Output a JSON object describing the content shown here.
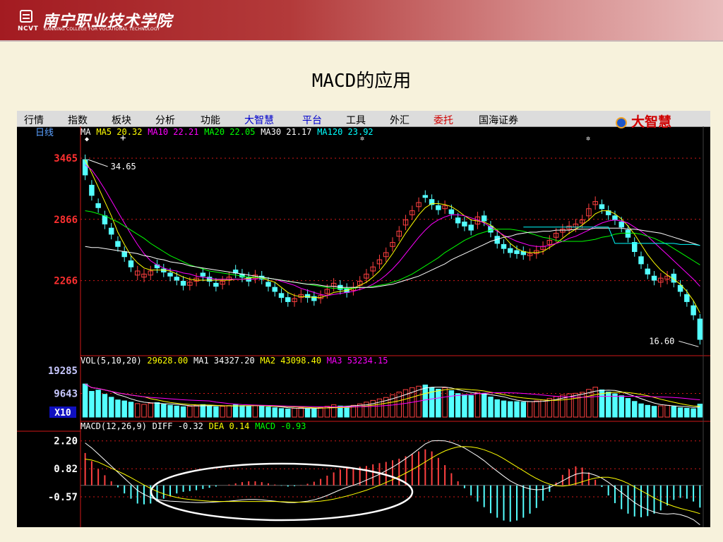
{
  "header": {
    "logo_name": "南宁职业技术学院",
    "logo_abbr": "NCVT",
    "logo_en": "NANNING COLLEGE FOR VOCATIONAL TECHNOLOGY"
  },
  "slide": {
    "title": "MACD的应用"
  },
  "menu": {
    "items": [
      {
        "label": "行情",
        "color": "#000000"
      },
      {
        "label": "指数",
        "color": "#000000"
      },
      {
        "label": "板块",
        "color": "#000000"
      },
      {
        "label": "分析",
        "color": "#000000"
      },
      {
        "label": "功能",
        "color": "#000000"
      },
      {
        "label": "大智慧",
        "color": "#0000cc"
      },
      {
        "label": "平台",
        "color": "#0000cc"
      },
      {
        "label": "工具",
        "color": "#000000"
      },
      {
        "label": "外汇",
        "color": "#000000"
      },
      {
        "label": "委托",
        "color": "#d00000"
      },
      {
        "label": "国海证券",
        "color": "#000000"
      }
    ],
    "brand": "大智慧"
  },
  "panels": {
    "price": {
      "period_label": "日线",
      "legend": [
        {
          "text": "MA",
          "color": "#ffffff"
        },
        {
          "text": "MA5 20.32",
          "color": "#ffff00"
        },
        {
          "text": "MA10 22.21",
          "color": "#ff00ff"
        },
        {
          "text": "MA20 22.05",
          "color": "#00ff00"
        },
        {
          "text": "MA30 21.17",
          "color": "#ffffff"
        },
        {
          "text": "MA120 23.92",
          "color": "#00ffff"
        }
      ],
      "ticks": [
        "3465",
        "2866",
        "2266"
      ],
      "high_label": "34.65",
      "low_label": "16.60"
    },
    "volume": {
      "legend": [
        {
          "text": "VOL(5,10,20)",
          "color": "#ffffff"
        },
        {
          "text": "29628.00",
          "color": "#ffff00"
        },
        {
          "text": "MA1 34327.20",
          "color": "#ffffff"
        },
        {
          "text": "MA2 43098.40",
          "color": "#ffff00"
        },
        {
          "text": "MA3 53234.15",
          "color": "#ff00ff"
        }
      ],
      "ticks": [
        "19285",
        "9643"
      ],
      "unit_label": "X10"
    },
    "macd": {
      "legend": [
        {
          "text": "MACD(12,26,9)",
          "color": "#ffffff"
        },
        {
          "text": "DIFF -0.32",
          "color": "#ffffff"
        },
        {
          "text": "DEA 0.14",
          "color": "#ffff00"
        },
        {
          "text": "MACD -0.93",
          "color": "#00ff00"
        }
      ],
      "ticks": [
        "2.20",
        "0.82",
        "-0.57"
      ]
    }
  },
  "colors": {
    "up": "#ff4040",
    "down": "#54ffff",
    "axis_red": "#d01818",
    "price_tick": "#ff3030",
    "vol_tick": "#c8c8ff"
  },
  "chart_data": {
    "type": "candlestick",
    "price_axis": [
      1300,
      3600
    ],
    "price_ticks": [
      34.65,
      28.66,
      22.66
    ],
    "annotations": {
      "high": 34.65,
      "low": 16.6
    },
    "close": [
      33.0,
      31.0,
      29.8,
      28.2,
      27.2,
      26.0,
      25.0,
      24.0,
      23.6,
      23.3,
      23.6,
      23.9,
      23.5,
      23.1,
      22.7,
      22.2,
      22.5,
      22.9,
      23.1,
      22.6,
      22.1,
      22.6,
      23.0,
      23.4,
      23.0,
      22.6,
      23.2,
      22.8,
      22.1,
      21.6,
      21.0,
      20.6,
      20.9,
      21.3,
      21.0,
      20.7,
      21.2,
      21.8,
      22.4,
      21.8,
      21.5,
      22.0,
      22.6,
      23.3,
      24.0,
      24.7,
      25.4,
      26.4,
      27.5,
      28.6,
      29.5,
      30.3,
      30.8,
      30.1,
      29.6,
      30.0,
      29.2,
      28.3,
      28.0,
      27.6,
      28.9,
      28.5,
      27.4,
      26.3,
      25.8,
      25.4,
      25.3,
      25.2,
      25.3,
      25.6,
      26.0,
      26.6,
      27.3,
      27.7,
      28.0,
      28.2,
      28.6,
      29.7,
      30.4,
      29.7,
      29.1,
      28.6,
      27.9,
      26.9,
      25.5,
      24.3,
      23.3,
      22.7,
      22.9,
      23.1,
      22.5,
      21.6,
      20.6,
      19.3,
      16.9
    ],
    "open": [
      34.5,
      32.0,
      30.2,
      29.0,
      27.8,
      26.5,
      25.5,
      24.6,
      23.2,
      23.0,
      23.2,
      24.2,
      23.8,
      23.4,
      23.0,
      22.6,
      22.2,
      22.6,
      23.4,
      23.0,
      22.4,
      22.3,
      22.7,
      23.7,
      23.3,
      23.0,
      22.9,
      23.1,
      22.5,
      22.0,
      21.4,
      21.0,
      20.6,
      21.0,
      21.3,
      21.1,
      20.9,
      21.4,
      22.1,
      22.2,
      21.9,
      21.7,
      22.2,
      22.9,
      23.6,
      24.3,
      25.0,
      26.0,
      27.0,
      28.1,
      29.1,
      29.9,
      31.0,
      30.6,
      30.0,
      29.7,
      29.6,
      28.8,
      28.4,
      28.1,
      28.2,
      29.0,
      28.0,
      27.0,
      26.2,
      25.8,
      25.6,
      25.5,
      25.1,
      25.3,
      25.7,
      26.2,
      26.9,
      27.4,
      27.7,
      27.9,
      28.3,
      29.0,
      30.1,
      30.1,
      29.5,
      29.0,
      28.4,
      27.6,
      26.4,
      25.0,
      23.8,
      23.1,
      22.5,
      22.8,
      23.3,
      22.2,
      21.3,
      20.2,
      18.9
    ],
    "volume": [
      13500,
      10500,
      11000,
      9300,
      8100,
      7000,
      6600,
      6100,
      5500,
      5200,
      5600,
      5900,
      5200,
      4800,
      4500,
      4200,
      4400,
      4800,
      5100,
      4600,
      4200,
      4400,
      4700,
      5000,
      4700,
      4400,
      4800,
      4600,
      4100,
      3800,
      3500,
      3300,
      3600,
      3800,
      3500,
      3400,
      3900,
      4400,
      5000,
      4500,
      4300,
      4800,
      5400,
      6100,
      6800,
      7400,
      8000,
      9100,
      10200,
      11200,
      12000,
      12600,
      13100,
      12100,
      11400,
      12000,
      10800,
      9600,
      9100,
      8800,
      10100,
      9500,
      8200,
      7100,
      6600,
      6300,
      6300,
      6100,
      6300,
      6600,
      7000,
      7600,
      8400,
      9000,
      9500,
      9700,
      10100,
      11300,
      12200,
      11100,
      10200,
      9500,
      8700,
      7600,
      6400,
      5400,
      4800,
      4400,
      4600,
      4800,
      4300,
      3800,
      3600,
      3400,
      5300
    ],
    "series": [
      {
        "name": "MA5",
        "values": [
          34.5,
          33.2,
          31.8,
          30.4,
          29.0,
          27.4,
          26.2,
          25.1,
          24.4,
          23.9,
          23.7,
          23.7,
          23.7,
          23.6,
          23.3,
          23.0,
          22.8,
          22.7,
          22.7,
          22.7,
          22.7,
          22.7,
          22.7,
          22.8,
          22.8,
          22.9,
          23.0,
          22.9,
          22.7,
          22.5,
          22.0,
          21.5,
          21.2,
          21.1,
          21.1,
          21.0,
          21.0,
          21.2,
          21.5,
          21.6,
          21.7,
          21.9,
          22.2,
          22.5,
          23.0,
          23.6,
          24.4,
          25.3,
          26.3,
          27.3,
          28.2,
          29.1,
          29.8,
          30.2,
          30.2,
          30.1,
          29.9,
          29.5,
          29.0,
          28.6,
          28.5,
          28.4,
          28.1,
          27.6,
          27.0,
          26.3,
          25.8,
          25.5,
          25.4,
          25.4,
          25.5,
          25.9,
          26.3,
          26.8,
          27.3,
          27.7,
          28.1,
          28.6,
          29.2,
          29.5,
          29.5,
          29.2,
          28.7,
          28.0,
          27.2,
          26.2,
          25.2,
          24.4,
          23.7,
          23.2,
          22.8,
          22.3,
          21.6,
          20.7,
          19.5
        ]
      },
      {
        "name": "MA10",
        "values": [
          34.0,
          33.5,
          32.6,
          31.6,
          30.5,
          29.4,
          28.3,
          27.2,
          26.2,
          25.3,
          24.6,
          24.2,
          23.9,
          23.7,
          23.6,
          23.4,
          23.3,
          23.1,
          23.0,
          22.9,
          22.8,
          22.8,
          22.8,
          22.8,
          22.8,
          22.8,
          22.8,
          22.9,
          22.9,
          22.8,
          22.6,
          22.4,
          22.2,
          21.9,
          21.7,
          21.5,
          21.3,
          21.2,
          21.3,
          21.4,
          21.5,
          21.6,
          21.8,
          22.0,
          22.3,
          22.7,
          23.2,
          23.8,
          24.5,
          25.3,
          26.1,
          26.9,
          27.6,
          28.2,
          28.6,
          28.9,
          29.1,
          29.1,
          29.0,
          28.8,
          28.6,
          28.3,
          27.9,
          27.5,
          27.1,
          26.8,
          26.5,
          26.3,
          26.1,
          26.0,
          26.0,
          26.1,
          26.3,
          26.5,
          26.8,
          27.0,
          27.3,
          27.6,
          28.0,
          28.3,
          28.5,
          28.6,
          28.5,
          28.3,
          27.9,
          27.5,
          27.0,
          26.4,
          25.8,
          25.2,
          24.6,
          24.0,
          23.4,
          22.8,
          22.1
        ]
      },
      {
        "name": "MA20",
        "values": [
          29.5,
          29.4,
          29.2,
          29.0,
          28.7,
          28.4,
          28.0,
          27.6,
          27.2,
          26.8,
          26.3,
          25.9,
          25.5,
          25.1,
          24.8,
          24.5,
          24.2,
          24.0,
          23.8,
          23.6,
          23.5,
          23.4,
          23.3,
          23.2,
          23.1,
          23.0,
          23.0,
          22.9,
          22.9,
          22.8,
          22.7,
          22.6,
          22.5,
          22.4,
          22.3,
          22.2,
          22.1,
          22.0,
          21.9,
          21.9,
          21.9,
          21.9,
          22.0,
          22.0,
          22.1,
          22.2,
          22.3,
          22.5,
          22.7,
          23.0,
          23.3,
          23.7,
          24.1,
          24.5,
          24.9,
          25.4,
          25.8,
          26.2,
          26.6,
          26.9,
          27.2,
          27.4,
          27.6,
          27.7,
          27.7,
          27.7,
          27.6,
          27.5,
          27.3,
          27.1,
          26.9,
          26.8,
          26.6,
          26.5,
          26.5,
          26.5,
          26.5,
          26.6,
          26.7,
          26.9,
          27.0,
          27.2,
          27.3,
          27.3,
          27.3,
          27.2,
          27.0,
          26.8,
          26.5,
          26.2,
          25.8,
          25.4,
          25.0,
          24.6,
          24.2
        ]
      },
      {
        "name": "MA30",
        "values": [
          26.0,
          25.9,
          25.9,
          25.8,
          25.7,
          25.6,
          25.5,
          25.4,
          25.3,
          25.1,
          25.0,
          24.8,
          24.7,
          24.5,
          24.4,
          24.3,
          24.1,
          24.0,
          23.9,
          23.8,
          23.7,
          23.6,
          23.5,
          23.4,
          23.3,
          23.2,
          23.1,
          23.0,
          22.9,
          22.8,
          22.7,
          22.6,
          22.5,
          22.4,
          22.3,
          22.3,
          22.2,
          22.1,
          22.1,
          22.0,
          22.0,
          22.0,
          22.0,
          22.0,
          22.0,
          22.1,
          22.2,
          22.3,
          22.5,
          22.7,
          22.9,
          23.1,
          23.4,
          23.7,
          24.0,
          24.3,
          24.7,
          25.0,
          25.3,
          25.6,
          25.9,
          26.2,
          26.5,
          26.7,
          26.9,
          27.0,
          27.2,
          27.3,
          27.4,
          27.4,
          27.5,
          27.5,
          27.6,
          27.6,
          27.6,
          27.7,
          27.7,
          27.7,
          27.8,
          27.8,
          27.8,
          27.8,
          27.8,
          27.7,
          27.7,
          27.6,
          27.5,
          27.4,
          27.3,
          27.1,
          26.9,
          26.7,
          26.5,
          26.3,
          26.1
        ]
      },
      {
        "name": "MA120",
        "values": [
          null,
          null,
          null,
          null,
          null,
          null,
          null,
          null,
          null,
          null,
          null,
          null,
          null,
          null,
          null,
          null,
          null,
          null,
          null,
          null,
          null,
          null,
          null,
          null,
          null,
          null,
          null,
          null,
          null,
          null,
          null,
          null,
          null,
          null,
          null,
          null,
          null,
          null,
          null,
          null,
          null,
          null,
          null,
          null,
          null,
          null,
          null,
          null,
          null,
          null,
          null,
          null,
          null,
          null,
          null,
          null,
          null,
          null,
          null,
          null,
          null,
          null,
          null,
          null,
          null,
          null,
          null,
          27.9,
          27.9,
          27.9,
          27.9,
          27.9,
          27.9,
          27.9,
          27.9,
          27.9,
          27.9,
          27.9,
          27.9,
          27.9,
          27.9,
          26.3,
          26.3,
          26.3,
          26.3,
          26.3,
          26.3,
          26.3,
          26.3,
          26.3,
          26.3,
          26.2,
          26.2,
          26.2,
          26.1
        ]
      },
      {
        "name": "DIFF",
        "values": [
          2.1,
          1.85,
          1.55,
          1.25,
          0.95,
          0.65,
          0.35,
          0.05,
          -0.25,
          -0.45,
          -0.6,
          -0.7,
          -0.75,
          -0.78,
          -0.8,
          -0.82,
          -0.84,
          -0.85,
          -0.85,
          -0.84,
          -0.82,
          -0.8,
          -0.78,
          -0.75,
          -0.72,
          -0.7,
          -0.7,
          -0.72,
          -0.75,
          -0.78,
          -0.82,
          -0.85,
          -0.85,
          -0.82,
          -0.78,
          -0.72,
          -0.62,
          -0.5,
          -0.36,
          -0.22,
          -0.1,
          0.0,
          0.12,
          0.26,
          0.4,
          0.55,
          0.72,
          0.9,
          1.1,
          1.32,
          1.55,
          1.8,
          2.05,
          2.2,
          2.22,
          2.2,
          2.12,
          2.0,
          1.85,
          1.65,
          1.45,
          1.22,
          0.95,
          0.7,
          0.45,
          0.22,
          0.05,
          -0.08,
          -0.18,
          -0.22,
          -0.2,
          -0.1,
          0.05,
          0.22,
          0.4,
          0.55,
          0.62,
          0.6,
          0.5,
          0.36,
          0.15,
          -0.1,
          -0.35,
          -0.6,
          -0.85,
          -1.05,
          -1.2,
          -1.32,
          -1.4,
          -1.42,
          -1.4,
          -1.45,
          -1.55,
          -1.7,
          -1.95
        ]
      },
      {
        "name": "DEA",
        "values": [
          1.3,
          1.25,
          1.15,
          1.0,
          0.85,
          0.7,
          0.55,
          0.38,
          0.2,
          0.02,
          -0.15,
          -0.3,
          -0.42,
          -0.52,
          -0.6,
          -0.66,
          -0.7,
          -0.73,
          -0.76,
          -0.78,
          -0.79,
          -0.8,
          -0.8,
          -0.8,
          -0.8,
          -0.8,
          -0.8,
          -0.8,
          -0.8,
          -0.8,
          -0.81,
          -0.82,
          -0.83,
          -0.83,
          -0.82,
          -0.81,
          -0.78,
          -0.74,
          -0.68,
          -0.61,
          -0.53,
          -0.44,
          -0.34,
          -0.24,
          -0.12,
          0.0,
          0.14,
          0.28,
          0.44,
          0.6,
          0.78,
          0.96,
          1.16,
          1.36,
          1.54,
          1.7,
          1.82,
          1.9,
          1.92,
          1.9,
          1.85,
          1.76,
          1.64,
          1.5,
          1.32,
          1.12,
          0.92,
          0.72,
          0.52,
          0.34,
          0.18,
          0.06,
          -0.02,
          -0.04,
          0.0,
          0.08,
          0.18,
          0.28,
          0.36,
          0.4,
          0.4,
          0.34,
          0.24,
          0.1,
          -0.08,
          -0.26,
          -0.44,
          -0.62,
          -0.78,
          -0.92,
          -1.04,
          -1.14,
          -1.22,
          -1.3,
          -1.4
        ]
      },
      {
        "name": "MACD",
        "values": [
          1.6,
          1.2,
          0.8,
          0.5,
          0.2,
          -0.1,
          -0.4,
          -0.66,
          -0.9,
          -0.94,
          -0.9,
          -0.8,
          -0.66,
          -0.52,
          -0.4,
          -0.32,
          -0.28,
          -0.24,
          -0.18,
          -0.12,
          -0.06,
          0.0,
          0.04,
          0.1,
          0.16,
          0.2,
          0.2,
          0.16,
          0.1,
          0.04,
          -0.02,
          -0.06,
          -0.04,
          0.02,
          0.08,
          0.18,
          0.32,
          0.48,
          0.64,
          0.78,
          0.86,
          0.88,
          0.92,
          0.96,
          1.04,
          1.1,
          1.16,
          1.24,
          1.32,
          1.44,
          1.54,
          1.68,
          1.78,
          1.68,
          1.36,
          1.0,
          0.6,
          0.2,
          -0.14,
          -0.5,
          -0.8,
          -1.08,
          -1.38,
          -1.6,
          -1.74,
          -1.8,
          -1.74,
          -1.6,
          -1.4,
          -1.12,
          -0.76,
          -0.32,
          0.14,
          0.52,
          0.8,
          0.94,
          0.88,
          0.64,
          0.28,
          -0.08,
          -0.5,
          -0.88,
          -1.18,
          -1.4,
          -1.54,
          -1.58,
          -1.52,
          -1.4,
          -1.24,
          -1.0,
          -0.72,
          -0.62,
          -0.66,
          -0.8,
          -1.1
        ]
      }
    ]
  }
}
